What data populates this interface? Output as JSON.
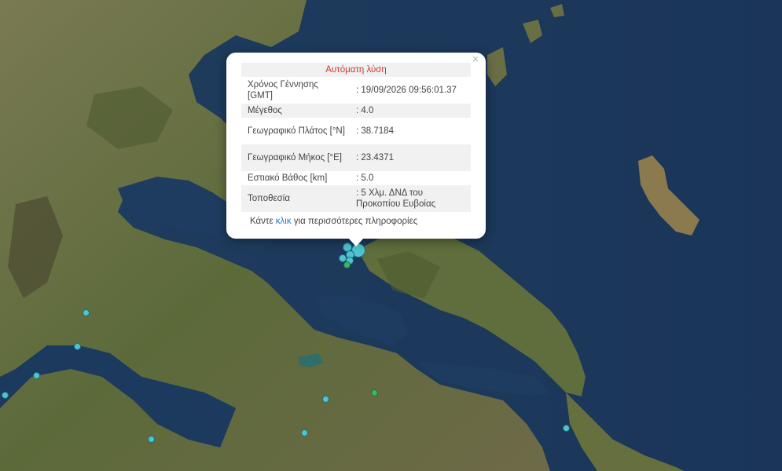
{
  "popup": {
    "title": "Αυτόματη λύση",
    "close_symbol": "×",
    "rows": [
      {
        "label": "Χρόνος Γέννησης [GMT]",
        "value": ": 19/09/2026 09:56:01.37"
      },
      {
        "label": "Μέγεθος",
        "value": ": 4.0"
      },
      {
        "label": "Γεωγραφικό Πλάτος [°N]",
        "value": ": 38.7184"
      },
      {
        "label": "Γεωγραφικό Μήκος [°E]",
        "value": ": 23.4371"
      },
      {
        "label": "Εστιακό Βάθος [km]",
        "value": ": 5.0"
      },
      {
        "label": "Τοποθεσία",
        "value": ": 5 Χλμ. ΔΝΔ του Προκοπίου Ευβοίας"
      }
    ],
    "more_prefix": "Κάντε ",
    "more_link": "κλικ",
    "more_suffix": " για περισσότερες πληροφορίες"
  },
  "colors": {
    "sea": "#1d3a5c",
    "land": "#5d6b3a",
    "quake_marker": "#4fc3d0",
    "quake_marker_green": "#3cb36a",
    "popup_title": "#c9392b",
    "link": "#2a78c9"
  }
}
